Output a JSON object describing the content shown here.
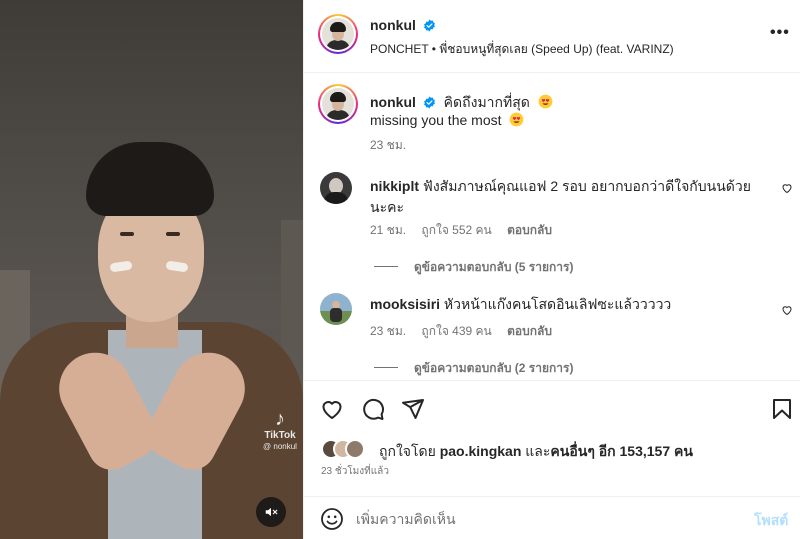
{
  "media": {
    "watermark_brand": "TikTok",
    "watermark_handle": "@ nonkul",
    "watermark_note_glyph": "♪",
    "mute_icon": "speaker-muted-icon"
  },
  "header": {
    "username": "nonkul",
    "audio": "PONCHET • พี่ชอบหนูที่สุดเลย (Speed Up) (feat. VARINZ)",
    "more_glyph": "•••"
  },
  "caption": {
    "username": "nonkul",
    "text_th": "คิดถึงมากที่สุด",
    "text_en": "missing you the most",
    "time": "23 ชม."
  },
  "comments": [
    {
      "username": "nikkiplt",
      "text": "ฟังสัมภาษณ์คุณแอฟ 2 รอบ อยากบอกว่าดีใจกับนนด้วยนะคะ",
      "time": "21 ชม.",
      "likes": "ถูกใจ 552 คน",
      "reply": "ตอบกลับ",
      "view_replies": "ดูข้อความตอบกลับ (5 รายการ)"
    },
    {
      "username": "mooksisiri",
      "text": "หัวหน้าแก๊งคนโสดอินเลิฟซะแล้ววววว",
      "time": "23 ชม.",
      "likes": "ถูกใจ 439 คน",
      "reply": "ตอบกลับ",
      "view_replies": "ดูข้อความตอบกลับ (2 รายการ)"
    }
  ],
  "likes": {
    "prefix": "ถูกใจโดย",
    "first_user": "pao.kingkan",
    "middle": "และ",
    "others": "คนอื่นๆ อีก 153,157 คน"
  },
  "post_time": "23 ชั่วโมงที่แล้ว",
  "comment_box": {
    "placeholder": "เพิ่มความคิดเห็น",
    "post_label": "โพสต์"
  },
  "colors": {
    "verified": "#0095f6",
    "post_button_disabled": "#b2dffc",
    "secondary_text": "#737373"
  }
}
